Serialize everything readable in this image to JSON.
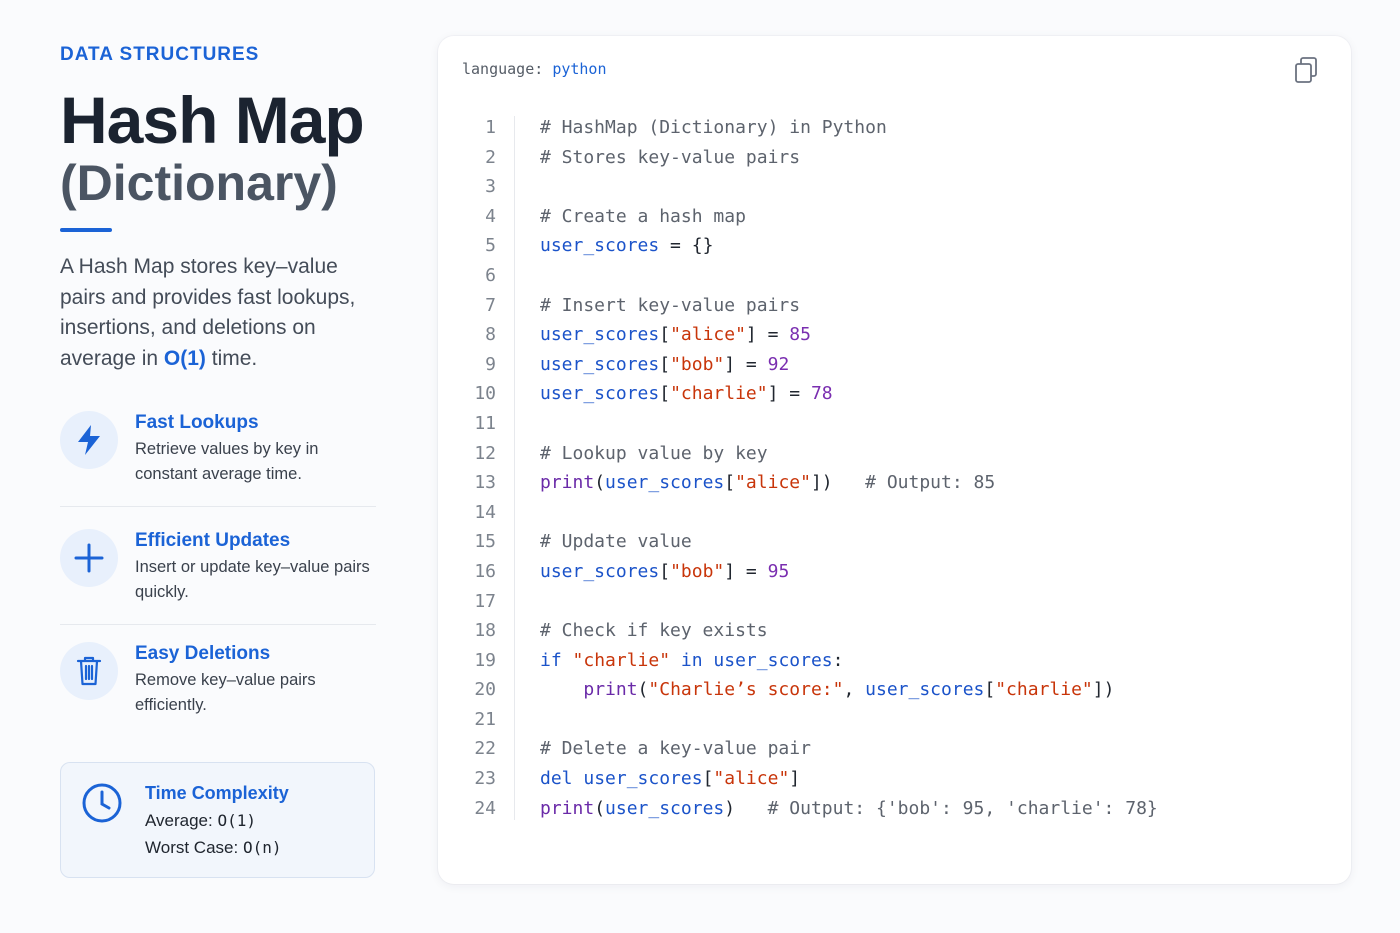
{
  "eyebrow": "DATA STRUCTURES",
  "title": "Hash Map",
  "subtitle": "(Dictionary)",
  "description": {
    "before": "A Hash Map stores key–value pairs and provides fast lookups, insertions, and deletions on average in ",
    "highlight": "O(1)",
    "after": " time."
  },
  "features": [
    {
      "icon": "lightning-icon",
      "title": "Fast Lookups",
      "text": "Retrieve values by key in constant average time."
    },
    {
      "icon": "plus-icon",
      "title": "Efficient Updates",
      "text": "Insert or update key–value pairs quickly."
    },
    {
      "icon": "trash-icon",
      "title": "Easy Deletions",
      "text": "Remove key–value pairs efficiently."
    }
  ],
  "complexity": {
    "icon": "clock-icon",
    "title": "Time Complexity",
    "average_label": "Average:",
    "average_value": "O(1)",
    "worst_label": "Worst Case:",
    "worst_value": "O(n)"
  },
  "code": {
    "language_label": "language:",
    "language_value": "python",
    "copy_icon": "copy-icon",
    "colors": {
      "accent": "#1b63d6",
      "string": "#c8350a",
      "number": "#7a2eb0",
      "comment": "#5d636d"
    },
    "lines": [
      [
        [
          "c",
          "# HashMap (Dictionary) in Python"
        ]
      ],
      [
        [
          "c",
          "# Stores key-value pairs"
        ]
      ],
      [],
      [
        [
          "c",
          "# Create a hash map"
        ]
      ],
      [
        [
          "v",
          "user_scores"
        ],
        [
          "p",
          " = {}"
        ]
      ],
      [],
      [
        [
          "c",
          "# Insert key-value pairs"
        ]
      ],
      [
        [
          "v",
          "user_scores"
        ],
        [
          "p",
          "["
        ],
        [
          "s",
          "\"alice\""
        ],
        [
          "p",
          "] = "
        ],
        [
          "n",
          "85"
        ]
      ],
      [
        [
          "v",
          "user_scores"
        ],
        [
          "p",
          "["
        ],
        [
          "s",
          "\"bob\""
        ],
        [
          "p",
          "] = "
        ],
        [
          "n",
          "92"
        ]
      ],
      [
        [
          "v",
          "user_scores"
        ],
        [
          "p",
          "["
        ],
        [
          "s",
          "\"charlie\""
        ],
        [
          "p",
          "] = "
        ],
        [
          "n",
          "78"
        ]
      ],
      [],
      [
        [
          "c",
          "# Lookup value by key"
        ]
      ],
      [
        [
          "f",
          "print"
        ],
        [
          "p",
          "("
        ],
        [
          "v",
          "user_scores"
        ],
        [
          "p",
          "["
        ],
        [
          "s",
          "\"alice\""
        ],
        [
          "p",
          "])   "
        ],
        [
          "c",
          "# Output: 85"
        ]
      ],
      [],
      [
        [
          "c",
          "# Update value"
        ]
      ],
      [
        [
          "v",
          "user_scores"
        ],
        [
          "p",
          "["
        ],
        [
          "s",
          "\"bob\""
        ],
        [
          "p",
          "] = "
        ],
        [
          "n",
          "95"
        ]
      ],
      [],
      [
        [
          "c",
          "# Check if key exists"
        ]
      ],
      [
        [
          "k",
          "if "
        ],
        [
          "s",
          "\"charlie\""
        ],
        [
          "k",
          " in "
        ],
        [
          "v",
          "user_scores"
        ],
        [
          "p",
          ":"
        ]
      ],
      [
        [
          "p",
          "    "
        ],
        [
          "f",
          "print"
        ],
        [
          "p",
          "("
        ],
        [
          "s",
          "\"Charlie’s score:\""
        ],
        [
          "p",
          ", "
        ],
        [
          "v",
          "user_scores"
        ],
        [
          "p",
          "["
        ],
        [
          "s",
          "\"charlie\""
        ],
        [
          "p",
          "])"
        ]
      ],
      [],
      [
        [
          "c",
          "# Delete a key-value pair"
        ]
      ],
      [
        [
          "k",
          "del "
        ],
        [
          "v",
          "user_scores"
        ],
        [
          "p",
          "["
        ],
        [
          "s",
          "\"alice\""
        ],
        [
          "p",
          "]"
        ]
      ],
      [
        [
          "f",
          "print"
        ],
        [
          "p",
          "("
        ],
        [
          "v",
          "user_scores"
        ],
        [
          "p",
          ")   "
        ],
        [
          "c",
          "# Output: {'bob': 95, 'charlie': 78}"
        ]
      ]
    ]
  }
}
